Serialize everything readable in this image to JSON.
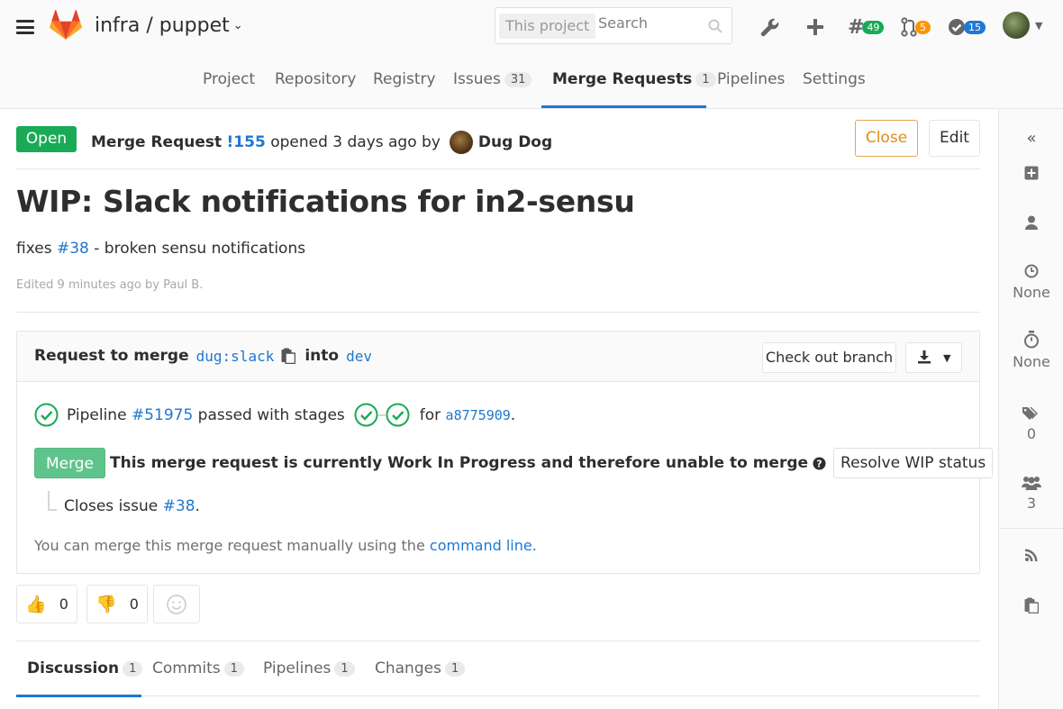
{
  "header": {
    "project_namespace": "infra",
    "separator": " / ",
    "project_name": "puppet",
    "search_scope": "This project",
    "search_placeholder": "Search",
    "todos_count": "49",
    "mr_count": "5",
    "issues_count": "15"
  },
  "nav": [
    {
      "label": "Project"
    },
    {
      "label": "Repository"
    },
    {
      "label": "Registry"
    },
    {
      "label": "Issues",
      "count": "31"
    },
    {
      "label": "Merge Requests",
      "count": "1"
    },
    {
      "label": "Pipelines"
    },
    {
      "label": "Settings"
    }
  ],
  "mr": {
    "state": "Open",
    "type_label": "Merge Request",
    "ref": "!155",
    "opened_text": "opened 3 days ago by",
    "author": "Dug Dog",
    "close_label": "Close",
    "edit_label": "Edit",
    "title": "WIP: Slack notifications for in2-sensu",
    "desc_prefix": "fixes",
    "desc_issue": "#38",
    "desc_suffix": "- broken sensu notifications",
    "edited": "Edited 9 minutes ago by Paul B."
  },
  "widget": {
    "request_to_merge": "Request to merge",
    "source_branch": "dug:slack",
    "into": "into",
    "target_branch": "dev",
    "checkout_label": "Check out branch",
    "pipeline_prefix": "Pipeline",
    "pipeline_id": "#51975",
    "pipeline_status": "passed with stages",
    "for_label": "for",
    "commit_sha": "a8775909",
    "merge_label": "Merge",
    "wip_message": "This merge request is currently Work In Progress and therefore unable to merge",
    "resolve_label": "Resolve WIP status",
    "closes_prefix": "Closes issue",
    "closes_issue": "#38",
    "manual_prefix": "You can merge this merge request manually using the",
    "manual_link": "command line."
  },
  "awards": {
    "thumbs_up_count": "0",
    "thumbs_down_count": "0"
  },
  "tabs": [
    {
      "label": "Discussion",
      "count": "1"
    },
    {
      "label": "Commits",
      "count": "1"
    },
    {
      "label": "Pipelines",
      "count": "1"
    },
    {
      "label": "Changes",
      "count": "1"
    }
  ],
  "sidebar": {
    "milestone": "None",
    "time_tracking": "None",
    "labels_count": "0",
    "participants_count": "3"
  },
  "colors": {
    "open_green": "#1aaa55",
    "link_blue": "#1f78d1",
    "close_orange": "#e48a11",
    "merge_green_disabled": "#5fc48b"
  }
}
